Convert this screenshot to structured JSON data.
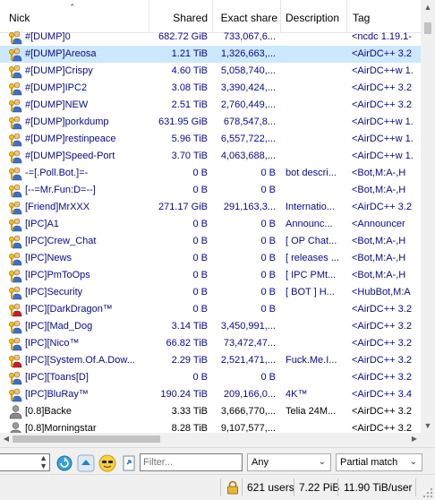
{
  "columns": {
    "nick": "Nick",
    "shared": "Shared",
    "exact": "Exact share",
    "description": "Description",
    "tag": "Tag"
  },
  "rows": [
    {
      "icon": "op-key-user-icon",
      "nick": "#[DUMP]0",
      "shared": "682.72 GiB",
      "exact": "733,067,6...",
      "description": "",
      "tag": "<ncdc 1.19.1-",
      "color": "#0a0a8a",
      "selected": false
    },
    {
      "icon": "op-key-user-icon",
      "nick": "#[DUMP]Areosa",
      "shared": "1.21 TiB",
      "exact": "1,326,663,...",
      "description": "",
      "tag": "<AirDC++ 3.2",
      "color": "#0a0a8a",
      "selected": true
    },
    {
      "icon": "op-key-user-icon",
      "nick": "#[DUMP]Crispy",
      "shared": "4.60 TiB",
      "exact": "5,058,740,...",
      "description": "",
      "tag": "<AirDC++w 1.",
      "color": "#0a0a8a",
      "selected": false
    },
    {
      "icon": "op-key-user-icon",
      "nick": "#[DUMP]IPC2",
      "shared": "3.08 TiB",
      "exact": "3,390,424,...",
      "description": "",
      "tag": "<AirDC++ 3.2",
      "color": "#0a0a8a",
      "selected": false
    },
    {
      "icon": "op-key-user-icon",
      "nick": "#[DUMP]NEW",
      "shared": "2.51 TiB",
      "exact": "2,760,449,...",
      "description": "",
      "tag": "<AirDC++ 3.2",
      "color": "#0a0a8a",
      "selected": false
    },
    {
      "icon": "op-key-user-icon",
      "nick": "#[DUMP]porkdump",
      "shared": "631.95 GiB",
      "exact": "678,547,8...",
      "description": "",
      "tag": "<AirDC++w 1.",
      "color": "#0a0a8a",
      "selected": false
    },
    {
      "icon": "op-key-user-icon",
      "nick": "#[DUMP]restinpeace",
      "shared": "5.96 TiB",
      "exact": "6,557,722,...",
      "description": "",
      "tag": "<AirDC++w 1.",
      "color": "#0a0a8a",
      "selected": false
    },
    {
      "icon": "op-key-user-icon",
      "nick": "#[DUMP]Speed-Port",
      "shared": "3.70 TiB",
      "exact": "4,063,688,...",
      "description": "",
      "tag": "<AirDC++w 1.",
      "color": "#0a0a8a",
      "selected": false
    },
    {
      "icon": "op-key-user-icon",
      "nick": "-=[.Poll.Bot.]=-",
      "shared": "0 B",
      "exact": "0 B",
      "description": "bot descri...",
      "tag": "<Bot,M:A-,H",
      "color": "#0a0a8a",
      "selected": false
    },
    {
      "icon": "op-key-user-icon",
      "nick": "[--=Mr.Fun:D=--]",
      "shared": "0 B",
      "exact": "0 B",
      "description": "",
      "tag": "<Bot,M:A-,H",
      "color": "#0a0a8a",
      "selected": false
    },
    {
      "icon": "op-key-user-icon",
      "nick": "[Friend]MrXXX",
      "shared": "271.17 GiB",
      "exact": "291,163,3...",
      "description": "Internatio...",
      "tag": "<AirDC++ 3.2",
      "color": "#0a0a8a",
      "selected": false
    },
    {
      "icon": "op-key-user-icon",
      "nick": "[IPC]A1",
      "shared": "0 B",
      "exact": "0 B",
      "description": "Announc...",
      "tag": "<Announcer",
      "color": "#0a0a8a",
      "selected": false
    },
    {
      "icon": "op-key-user-icon",
      "nick": "[IPC]Crew_Chat",
      "shared": "0 B",
      "exact": "0 B",
      "description": "[ OP Chat...",
      "tag": "<Bot,M:A-,H",
      "color": "#0a0a8a",
      "selected": false
    },
    {
      "icon": "op-key-user-icon",
      "nick": "[IPC]News",
      "shared": "0 B",
      "exact": "0 B",
      "description": "[ releases ...",
      "tag": "<Bot,M:A-,H",
      "color": "#0a0a8a",
      "selected": false
    },
    {
      "icon": "op-key-user-icon",
      "nick": "[IPC]PmToOps",
      "shared": "0 B",
      "exact": "0 B",
      "description": "[ IPC PMt...",
      "tag": "<Bot,M:A-,H",
      "color": "#0a0a8a",
      "selected": false
    },
    {
      "icon": "op-key-user-icon",
      "nick": "[IPC]Security",
      "shared": "0 B",
      "exact": "0 B",
      "description": "[ BOT ] H...",
      "tag": "<HubBot,M:A",
      "color": "#0a0a8a",
      "selected": false
    },
    {
      "icon": "op-key-red-user-icon",
      "nick": "[IPC][DarkDragon™",
      "shared": "0 B",
      "exact": "0 B",
      "description": "",
      "tag": "<AirDC++ 3.2",
      "color": "#0a0a8a",
      "selected": false
    },
    {
      "icon": "op-key-user-icon",
      "nick": "[IPC][Mad_Dog",
      "shared": "3.14 TiB",
      "exact": "3,450,991,...",
      "description": "",
      "tag": "<AirDC++ 3.2",
      "color": "#0a0a8a",
      "selected": false
    },
    {
      "icon": "op-key-user-icon",
      "nick": "[IPC][Nico™",
      "shared": "66.82 TiB",
      "exact": "73,472,47...",
      "description": "",
      "tag": "<AirDC++ 3.2",
      "color": "#0a0a8a",
      "selected": false
    },
    {
      "icon": "op-key-red-user-icon",
      "nick": "[IPC][System.Of.A.Dow...",
      "shared": "2.29 TiB",
      "exact": "2,521,471,...",
      "description": "Fuck.Me.I...",
      "tag": "<AirDC++ 3.2",
      "color": "#0a0a8a",
      "selected": false
    },
    {
      "icon": "op-key-user-icon",
      "nick": "[IPC][Toans[D]",
      "shared": "0 B",
      "exact": "0 B",
      "description": "",
      "tag": "<AirDC++ 3.2",
      "color": "#0a0a8a",
      "selected": false
    },
    {
      "icon": "op-key-user-icon",
      "nick": "[IPC]BluRay™",
      "shared": "190.24 TiB",
      "exact": "209,166,0...",
      "description": "4K™",
      "tag": "<AirDC++ 3.4",
      "color": "#0a0a8a",
      "selected": false
    },
    {
      "icon": "user-icon",
      "nick": "[0.8]Backe",
      "shared": "3.33 TiB",
      "exact": "3,666,770,...",
      "description": "Telia 24M...",
      "tag": "<AirDC++ 3.2",
      "color": "#000000",
      "selected": false
    },
    {
      "icon": "user-icon",
      "nick": "[0.8]Morningstar",
      "shared": "8.28 TiB",
      "exact": "9,107,577,...",
      "description": "",
      "tag": "<AirDC++ 3.2",
      "color": "#000000",
      "selected": false
    }
  ],
  "toolbar": {
    "filter_placeholder": "Filter...",
    "column_select": "Any",
    "match_select": "Partial match"
  },
  "status": {
    "users": "621 users",
    "total_share": "7.22 PiB",
    "avg_share": "11.90 TiB/user"
  },
  "colors": {
    "op_nick": "#0a0a8a",
    "normal_nick": "#000000",
    "selected_row": "#cce8ff"
  }
}
